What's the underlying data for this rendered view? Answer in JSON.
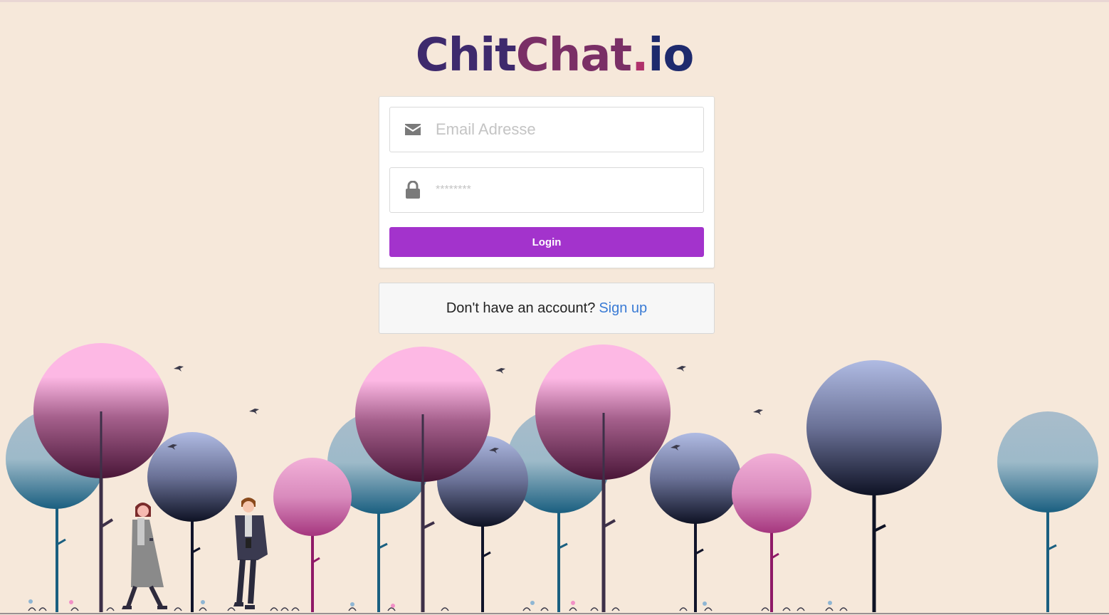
{
  "brand": {
    "part1": "Chit",
    "part2": "Chat",
    "dot": ".",
    "part3": "io"
  },
  "login_form": {
    "email_placeholder": "Email Adresse",
    "password_placeholder": "********",
    "login_label": "Login"
  },
  "signup": {
    "prompt": "Don't have an account?",
    "link_label": "Sign up"
  },
  "icons": {
    "email": "envelope-icon",
    "password": "lock-icon"
  },
  "colors": {
    "background": "#f6e8da",
    "button": "#a333cc",
    "link": "#3a7bd5"
  }
}
